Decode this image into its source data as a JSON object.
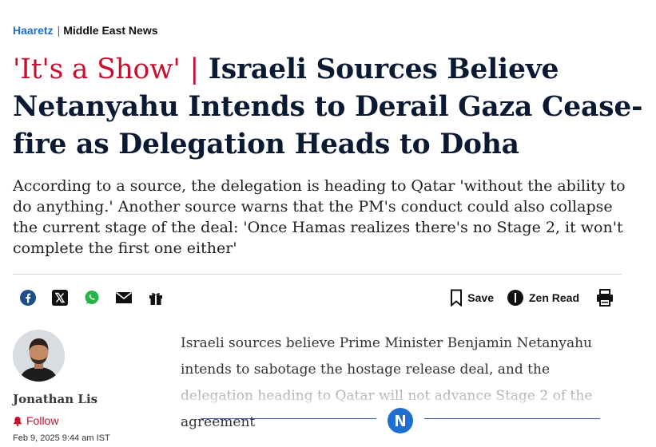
{
  "breadcrumb": {
    "brand": "Haaretz",
    "separator": "|",
    "section": "Middle East News"
  },
  "headline": {
    "kicker": "'It's a Show'",
    "separator": "|",
    "text": "Israeli Sources Believe Netanyahu Intends to Derail Gaza Cease-fire as Delegation Heads to Doha"
  },
  "subhead": "According to a source, the delegation is heading to Qatar 'without the ability to do anything.' Another source warns that the PM's conduct could also collapse the current stage of the deal: 'Once Hamas realizes there's no Stage 2, it won't complete the first one either'",
  "share": {
    "icons": [
      "facebook-icon",
      "x-icon",
      "whatsapp-icon",
      "mail-icon",
      "gift-icon"
    ]
  },
  "tools": {
    "save_label": "Save",
    "zen_label": "Zen Read"
  },
  "author": {
    "name": "Jonathan Lis",
    "follow_label": "Follow",
    "date": "Feb 9, 2025 9:44 am IST"
  },
  "article": {
    "body": "Israeli sources believe Prime Minister Benjamin Netanyahu intends to sabotage the hostage release deal, and the delegation heading to Qatar will not advance Stage 2 of the agreement"
  },
  "colors": {
    "brand_blue": "#1f6fd1",
    "kicker_red": "#c8102e",
    "headline": "#0b1a33"
  }
}
